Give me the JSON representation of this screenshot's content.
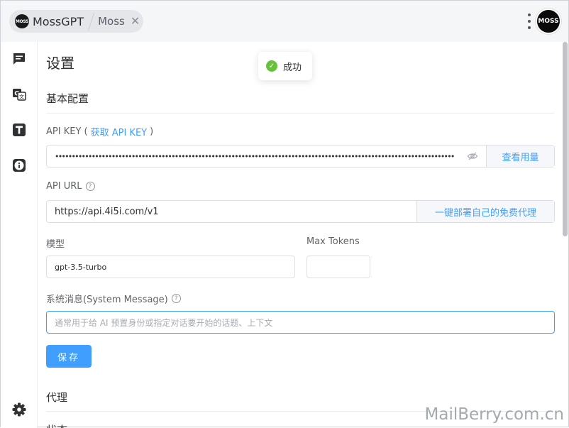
{
  "tabs": {
    "app_title": "MossGPT",
    "logo_text": "MOSS",
    "current_tab": "Moss",
    "close_glyph": "✕"
  },
  "avatar_text": "MOSS",
  "sidebar": {
    "icons": [
      "chat-icon",
      "translate-icon",
      "text-icon",
      "info-icon",
      "settings-icon"
    ]
  },
  "settings": {
    "page_title": "设置",
    "basic_section": "基本配置",
    "api_key": {
      "label_prefix": "API KEY (",
      "link": "获取 API KEY",
      "label_suffix": ")",
      "masked_value": "••••••••••••••••••••••••••••••••••••••••••••••••••••••••••••••••••••••••••••••••••••••••••••••••••••••••••••••••••••••••",
      "button": "查看用量"
    },
    "api_url": {
      "label": "API URL",
      "value": "https://api.4i5i.com/v1",
      "button": "一键部署自己的免费代理"
    },
    "model": {
      "label": "模型",
      "value": "gpt-3.5-turbo"
    },
    "max_tokens": {
      "label": "Max Tokens",
      "value": ""
    },
    "system_message": {
      "label": "系统消息(System Message)",
      "placeholder": "通常用于给 AI 预置身份或指定对话要开始的话题、上下文"
    },
    "save_button": "保存",
    "proxy_section": "代理",
    "next_section_partial": "状态"
  },
  "toast": {
    "message": "成功",
    "check_glyph": "✓"
  },
  "watermark": "MailBerry.com.cn",
  "colors": {
    "primary": "#409eff",
    "success": "#67c23a",
    "border": "#dcdfe6"
  }
}
